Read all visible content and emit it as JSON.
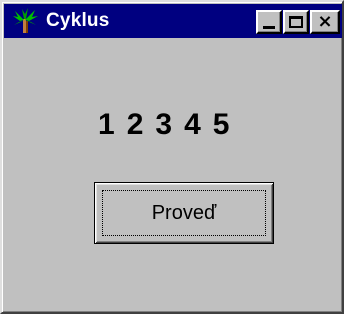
{
  "window": {
    "title": "Cyklus",
    "icon": "application-icon",
    "controls": {
      "minimize": "minimize-icon",
      "maximize": "maximize-icon",
      "close": "close-icon"
    }
  },
  "output": {
    "numbers": [
      "1",
      "2",
      "3",
      "4",
      "5"
    ]
  },
  "actions": {
    "proved_label": "Proveď"
  },
  "colors": {
    "titlebar": "#000080",
    "face": "#c0c0c0",
    "text": "#000000",
    "title_text": "#ffffff"
  }
}
